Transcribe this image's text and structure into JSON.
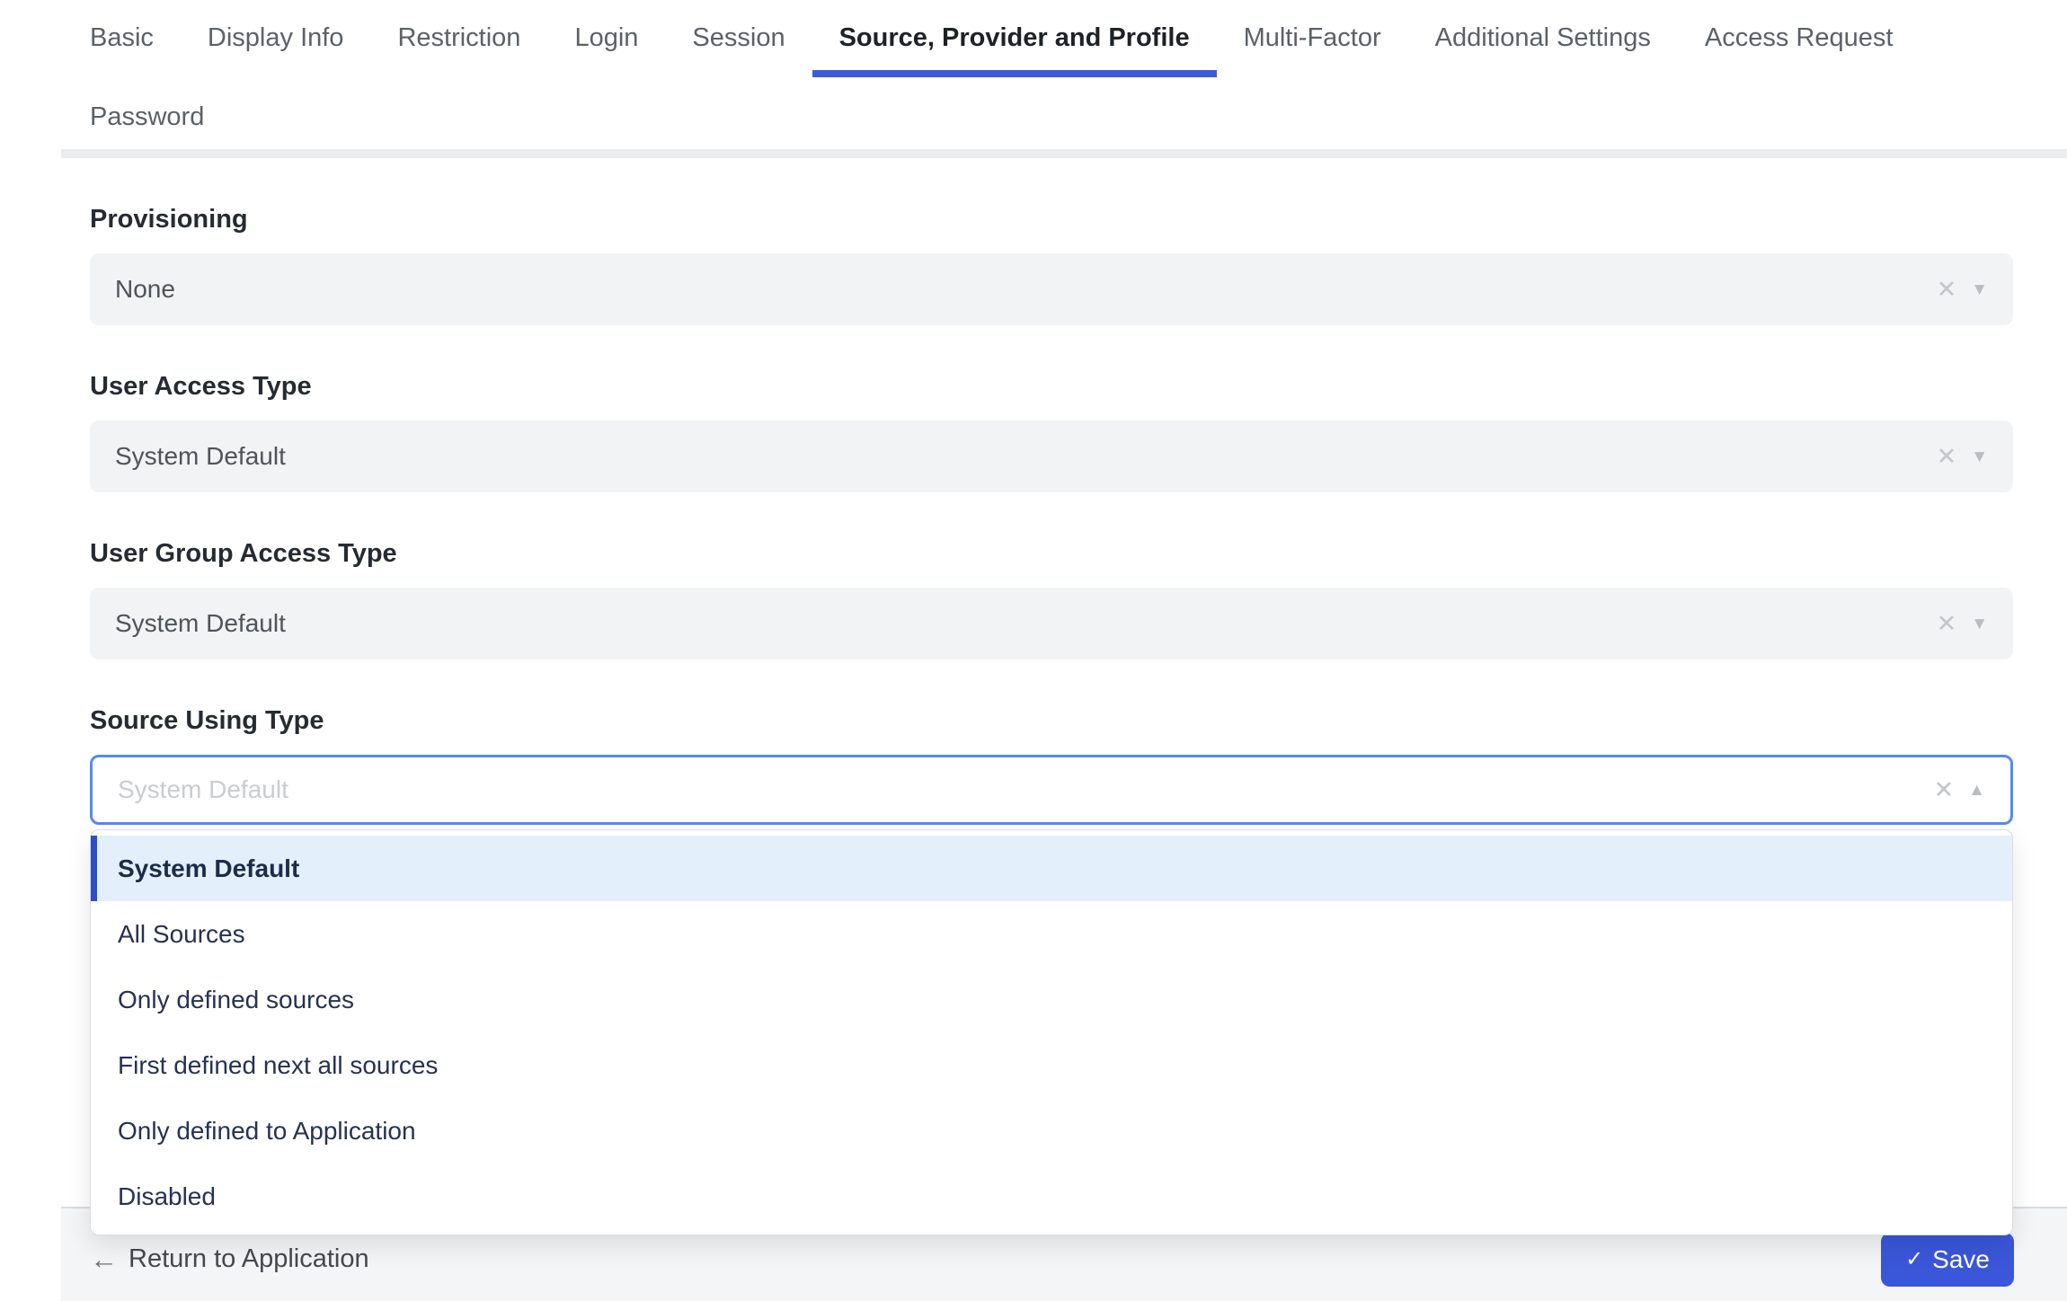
{
  "tabs": {
    "row1": [
      "Basic",
      "Display Info",
      "Restriction",
      "Login",
      "Session",
      "Source, Provider and Profile",
      "Multi-Factor",
      "Additional Settings",
      "Access Request"
    ],
    "row2": [
      "Password"
    ],
    "active_tab": "Source, Provider and Profile"
  },
  "form": {
    "fields": [
      {
        "label": "Provisioning",
        "value": "None"
      },
      {
        "label": "User Access Type",
        "value": "System Default"
      },
      {
        "label": "User Group Access Type",
        "value": "System Default"
      },
      {
        "label": "Source Using Type",
        "value": "",
        "placeholder": "System Default",
        "state": "open"
      }
    ]
  },
  "dropdown": {
    "selected": "System Default",
    "options": [
      "System Default",
      "All Sources",
      "Only defined sources",
      "First defined next all sources",
      "Only defined to Application",
      "Disabled"
    ]
  },
  "footer": {
    "return_label": "Return to Application",
    "save_label": "Save"
  },
  "icons": {
    "clear": "✕",
    "caret_down": "▼",
    "caret_up": "▲",
    "arrow_left": "←",
    "check": "✓"
  },
  "colors": {
    "accent_blue": "#3a57d9",
    "tab_underline": "#3a5cd8",
    "focus_border": "#568af2",
    "selected_option_bg": "#e3f0fc",
    "selected_option_bar": "#2d4ec9",
    "field_bg": "#f1f3f4",
    "footer_bg": "#f4f5f6"
  }
}
